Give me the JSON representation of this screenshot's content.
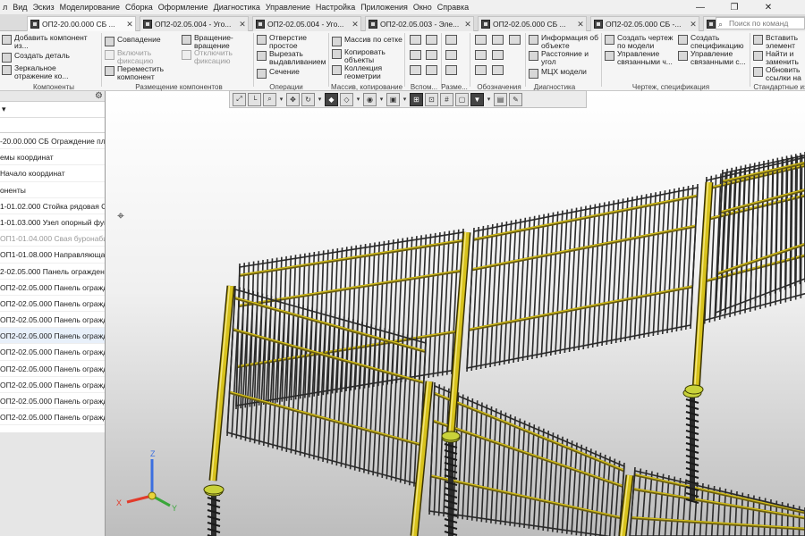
{
  "menubar": {
    "items": [
      "л",
      "Вид",
      "Эскиз",
      "Моделирование",
      "Сборка",
      "Оформление",
      "Диагностика",
      "Управление",
      "Настройка",
      "Приложения",
      "Окно",
      "Справка"
    ]
  },
  "tabs": [
    {
      "label": "ОП2-20.00.000 СБ ..."
    },
    {
      "label": "ОП2-02.05.004 - Уго..."
    },
    {
      "label": "ОП2-02.05.004 - Уго..."
    },
    {
      "label": "ОП2-02.05.003 - Эле..."
    },
    {
      "label": "ОП2-02.05.000 СБ ..."
    },
    {
      "label": "ОП2-02.05.000 СБ -..."
    },
    {
      "label": "ОП2-02.05.002 - Уго..."
    }
  ],
  "search": {
    "placeholder": "Поиск по команд"
  },
  "ribbon": {
    "components": {
      "add": "Добавить компонент из...",
      "create": "Создать деталь",
      "mirror": "Зеркальное отражение ко...",
      "group": "Компоненты"
    },
    "placement": {
      "align": "Совпадение",
      "rotate": "Вращение-вращение",
      "enable": "Включить фиксацию",
      "disable": "Отключить фиксацию",
      "move": "Переместить компонент",
      "group": "Размещение компонентов"
    },
    "operations": {
      "hole": "Отверстие простое",
      "cut": "Вырезать выдавливанием",
      "section": "Сечение",
      "group": "Операции"
    },
    "array": {
      "grid": "Массив по сетке",
      "copy": "Копировать объекты",
      "collection": "Коллекция геометрии",
      "group": "Массив, копирование"
    },
    "aux": {
      "group": "Вспом..."
    },
    "dims": {
      "group": "Разме..."
    },
    "marks": {
      "group": "Обозначения"
    },
    "diagnostics": {
      "info": "Информация об объекте",
      "distance": "Расстояние и угол",
      "mcc": "МЦХ модели",
      "group": "Диагностика"
    },
    "drawing": {
      "create": "Создать чертеж по модели",
      "create_spec": "Создать спецификацию",
      "manage": "Управление связанными ч...",
      "manage_spec": "Управление связанными с...",
      "group": "Чертеж, спецификация"
    },
    "standard": {
      "insert": "Вставить элемент",
      "replace": "Найти и заменить",
      "update": "Обновить ссылки на",
      "group": "Стандартные изде"
    }
  },
  "tree": {
    "items": [
      {
        "label": "-20.00.000 СБ Ограждение пло",
        "state": "normal"
      },
      {
        "label": "емы координат",
        "state": "normal"
      },
      {
        "label": "Начало координат",
        "state": "normal"
      },
      {
        "label": "оненты",
        "state": "normal"
      },
      {
        "label": "1-01.02.000 Стойка рядовая СТ",
        "state": "normal"
      },
      {
        "label": "1-01.03.000 Узел опорный фунд",
        "state": "normal"
      },
      {
        "label": "ОП1-01.04.000 Свая буронабив",
        "state": "dim"
      },
      {
        "label": "ОП1-01.08.000 Направляющая",
        "state": "normal"
      },
      {
        "label": "2-02.05.000 Панель ограждени",
        "state": "normal"
      },
      {
        "label": "ОП2-02.05.000 Панель огражд",
        "state": "normal"
      },
      {
        "label": "ОП2-02.05.000 Панель огражд",
        "state": "normal"
      },
      {
        "label": "ОП2-02.05.000 Панель огражд",
        "state": "normal"
      },
      {
        "label": "ОП2-02.05.000 Панель огражд",
        "state": "selected"
      },
      {
        "label": "ОП2-02.05.000 Панель огражд",
        "state": "normal"
      },
      {
        "label": "ОП2-02.05.000 Панель огражд",
        "state": "normal"
      },
      {
        "label": "ОП2-02.05.000 Панель огражд",
        "state": "normal"
      },
      {
        "label": "ОП2-02.05.000 Панель огражд",
        "state": "normal"
      },
      {
        "label": "ОП2-02.05.000 Панель огражд",
        "state": "normal"
      }
    ]
  },
  "triad": {
    "x": "X",
    "y": "Y",
    "z": "Z"
  },
  "colors": {
    "rail": "#d7c21c",
    "railDark": "#6a5d10",
    "steel": "#2a2a2a",
    "axisX": "#e23b2b",
    "axisY": "#3aa63a",
    "axisZ": "#3b6fe0"
  }
}
